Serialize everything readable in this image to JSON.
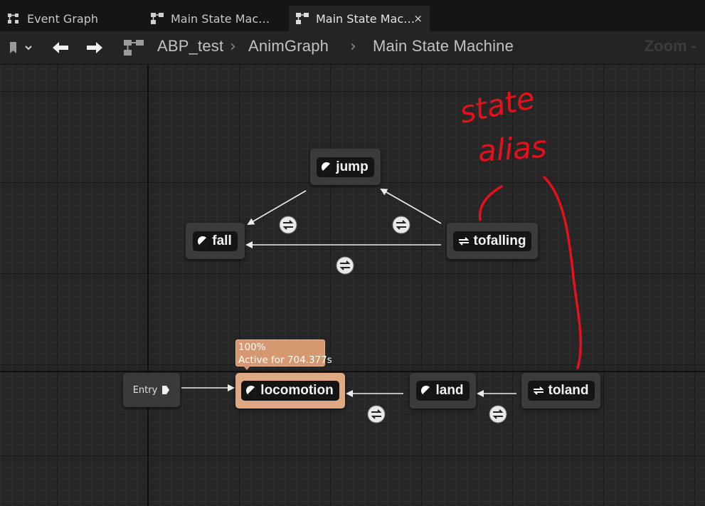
{
  "tabs": [
    {
      "label": "Event Graph",
      "icon": "event-graph-icon"
    },
    {
      "label": "Main State Mac…",
      "icon": "state-machine-icon"
    },
    {
      "label": "Main State Mac…",
      "icon": "state-machine-icon",
      "active": true,
      "close": "×"
    }
  ],
  "breadcrumb": {
    "items": [
      "ABP_test",
      "AnimGraph",
      "Main State Machine"
    ],
    "separator": "›",
    "zoom": "Zoom -"
  },
  "graph": {
    "states": {
      "jump": "jump",
      "fall": "fall",
      "tofalling": "tofalling",
      "locomotion": "locomotion",
      "land": "land",
      "toland": "toland"
    },
    "entry": "Entry",
    "tooltip": {
      "percent": "100%",
      "active_text": "Active for 704.377s"
    },
    "annotation": {
      "line1": "state",
      "line2": "alias",
      "color": "#e8101a"
    }
  },
  "colors": {
    "active_state": "#dfa985",
    "tooltip": "#d59870",
    "annotation": "#e8101a"
  }
}
